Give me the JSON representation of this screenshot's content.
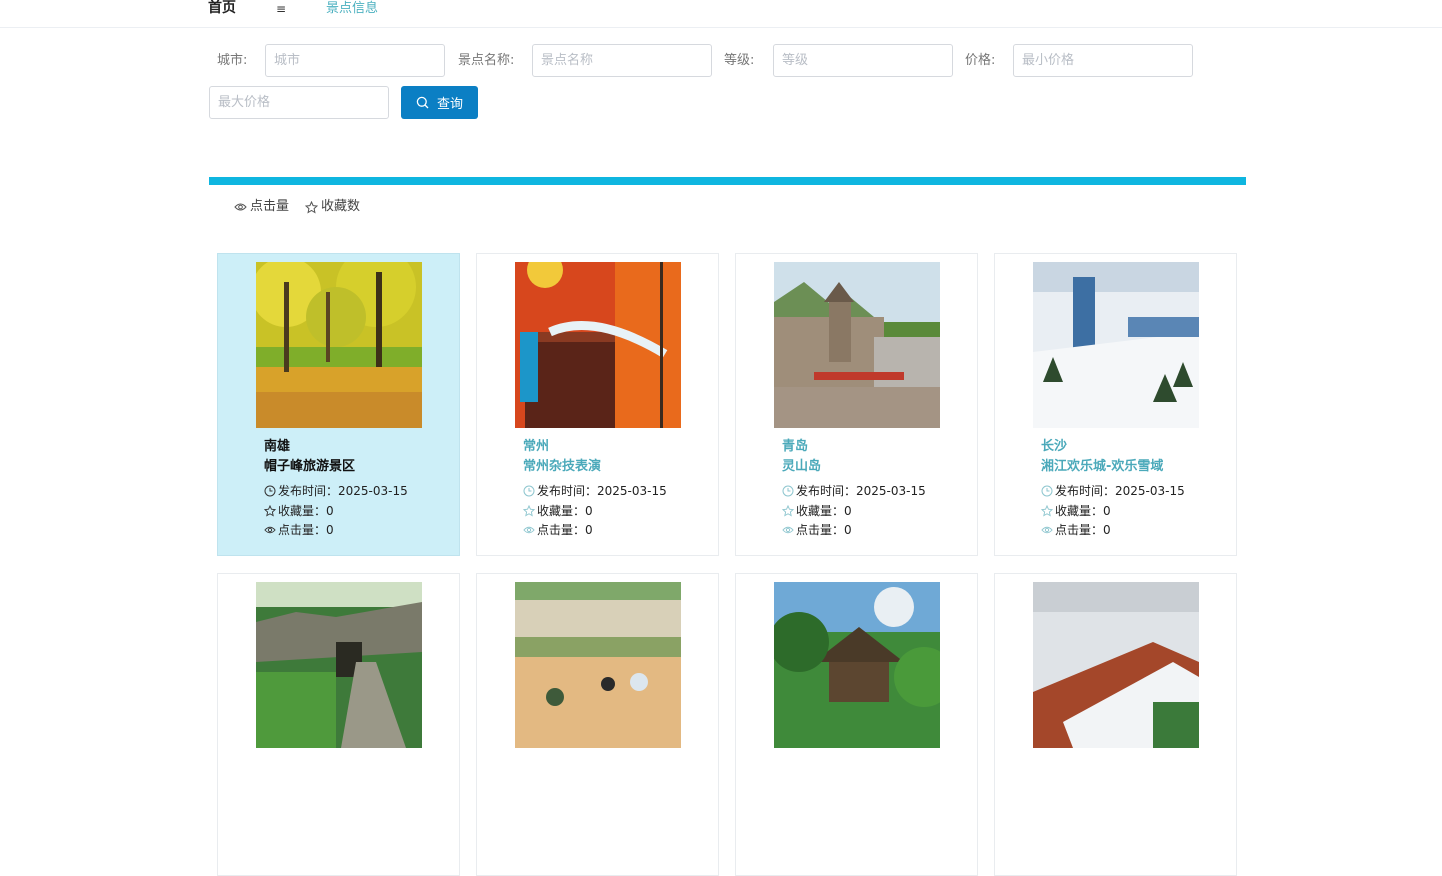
{
  "nav": {
    "home": "首页",
    "menu_icon": "≡",
    "info": "景点信息"
  },
  "search": {
    "city_label": "城市:",
    "city_placeholder": "城市",
    "spot_label": "景点名称:",
    "spot_placeholder": "景点名称",
    "level_label": "等级:",
    "level_placeholder": "等级",
    "price_label": "价格:",
    "min_placeholder": "最小价格",
    "max_placeholder": "最大价格",
    "button": "查询"
  },
  "sort": {
    "clicks": "点击量",
    "favorites": "收藏数"
  },
  "colors": {
    "accent": "#0b7fc4",
    "bar": "#0fb6e0",
    "title": "#4ba9ba",
    "active_card": "#cdeff8"
  },
  "cards": [
    {
      "city": "南雄",
      "name": "帽子峰旅游景区",
      "publish": "发布时间：2025-03-15",
      "fav": "收藏量：0",
      "clicks": "点击量：0"
    },
    {
      "city": "常州",
      "name": "常州杂技表演",
      "publish": "发布时间：2025-03-15",
      "fav": "收藏量：0",
      "clicks": "点击量：0"
    },
    {
      "city": "青岛",
      "name": "灵山岛",
      "publish": "发布时间：2025-03-15",
      "fav": "收藏量：0",
      "clicks": "点击量：0"
    },
    {
      "city": "长沙",
      "name": "湘江欢乐城-欢乐雪域",
      "publish": "发布时间：2025-03-15",
      "fav": "收藏量：0",
      "clicks": "点击量：0"
    },
    {},
    {},
    {},
    {}
  ]
}
